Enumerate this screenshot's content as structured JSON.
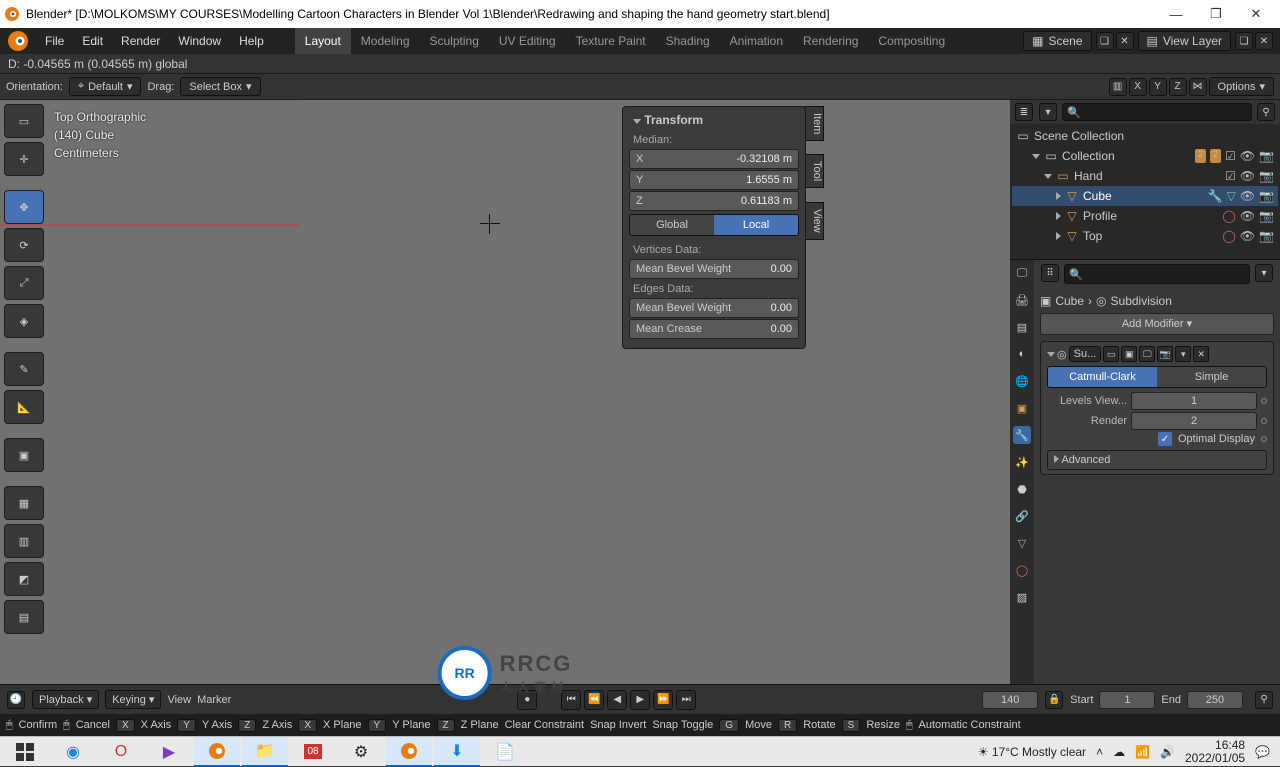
{
  "title": "Blender* [D:\\MOLKOMS\\MY COURSES\\Modelling  Cartoon Characters in Blender Vol 1\\Blender\\Redrawing and shaping the hand geometry start.blend]",
  "menubar": [
    "File",
    "Edit",
    "Render",
    "Window",
    "Help"
  ],
  "workspaces": [
    "Layout",
    "Modeling",
    "Sculpting",
    "UV Editing",
    "Texture Paint",
    "Shading",
    "Animation",
    "Rendering",
    "Compositing"
  ],
  "active_workspace": "Layout",
  "scene_label": "Scene",
  "viewlayer_label": "View Layer",
  "operator_status": "D: -0.04565 m (0.04565 m) global",
  "v3dbar": {
    "orientation_label": "Orientation:",
    "orientation_value": "Default",
    "drag_label": "Drag:",
    "drag_value": "Select Box",
    "axes": [
      "X",
      "Y",
      "Z"
    ],
    "options": "Options"
  },
  "overlay": {
    "line1": "Top Orthographic",
    "line2": "(140) Cube",
    "line3": "Centimeters"
  },
  "gizmo": {
    "x": "X",
    "y": "Y",
    "z": "Z"
  },
  "npanel": {
    "title": "Transform",
    "median": "Median:",
    "X": "X",
    "Y": "Y",
    "Z": "Z",
    "xval": "-0.32108 m",
    "yval": "1.6555 m",
    "zval": "0.61183 m",
    "global": "Global",
    "local": "Local",
    "verts_header": "Vertices Data:",
    "mean_bevel": "Mean Bevel Weight",
    "mbw_v": "0.00",
    "edges_header": "Edges Data:",
    "mbw_e": "0.00",
    "mean_crease": "Mean Crease",
    "mc_v": "0.00"
  },
  "sidebar_tabs": [
    "Item",
    "Tool",
    "View"
  ],
  "outliner": {
    "search_placeholder": "",
    "root": "Scene Collection",
    "collection": "Collection",
    "hand": "Hand",
    "cube": "Cube",
    "profile": "Profile",
    "top": "Top",
    "badge2a": "2",
    "badge2b": "2"
  },
  "props": {
    "crumb_obj": "Cube",
    "crumb_sep": "›",
    "crumb_mod": "Subdivision",
    "add_modifier": "Add Modifier",
    "mod_name": "Su...",
    "catmull": "Catmull-Clark",
    "simple": "Simple",
    "levels_view": "Levels View...",
    "levels_view_v": "1",
    "render": "Render",
    "render_v": "2",
    "optimal": "Optimal Display",
    "advanced": "Advanced"
  },
  "timeline": {
    "playback": "Playback",
    "keying": "Keying",
    "view": "View",
    "marker": "Marker",
    "frame": "140",
    "start_lbl": "Start",
    "start_v": "1",
    "end_lbl": "End",
    "end_v": "250"
  },
  "statusbar": {
    "confirm": "Confirm",
    "cancel": "Cancel",
    "x": "X",
    "xaxis": "X Axis",
    "y": "Y",
    "yaxis": "Y Axis",
    "z": "Z",
    "zaxis": "Z Axis",
    "xp": "X",
    "xplane": "X Plane",
    "yp": "Y",
    "yplane": "Y Plane",
    "zp": "Z",
    "zplane": "Z Plane",
    "clear": "Clear Constraint",
    "snapinv": "Snap Invert",
    "snaptog": "Snap Toggle",
    "move": "Move",
    "rotate": "Rotate",
    "resize": "Resize",
    "autoc": "Automatic Constraint",
    "g": "G",
    "r": "R",
    "s": "S"
  },
  "taskbar": {
    "weather": "17°C  Mostly clear",
    "time": "16:48",
    "date": "2022/01/05"
  },
  "watermark": {
    "brand": "RR",
    "text": "RRCG",
    "sub": "人人素材"
  }
}
